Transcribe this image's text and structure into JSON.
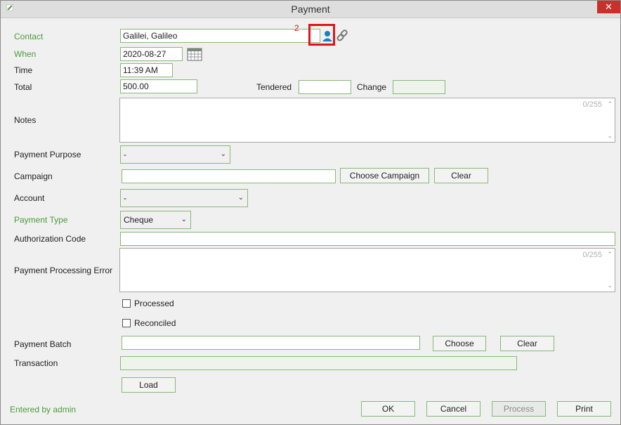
{
  "window": {
    "title": "Payment",
    "close_label": "✕"
  },
  "contact": {
    "label": "Contact",
    "value": "Galilei, Galileo",
    "badge": "2"
  },
  "when": {
    "label": "When",
    "value": "2020-08-27"
  },
  "time": {
    "label": "Time",
    "value": "11:39 AM"
  },
  "total": {
    "label": "Total",
    "value": "500.00"
  },
  "tendered": {
    "label": "Tendered",
    "value": ""
  },
  "change": {
    "label": "Change",
    "value": ""
  },
  "notes": {
    "label": "Notes",
    "counter": "0/255"
  },
  "payment_purpose": {
    "label": "Payment Purpose",
    "selected": "-"
  },
  "campaign": {
    "label": "Campaign",
    "value": "",
    "choose_label": "Choose Campaign",
    "clear_label": "Clear"
  },
  "account": {
    "label": "Account",
    "selected": "-"
  },
  "payment_type": {
    "label": "Payment Type",
    "selected": "Cheque"
  },
  "authorization_code": {
    "label": "Authorization Code",
    "value": ""
  },
  "processing_error": {
    "label": "Payment Processing Error",
    "counter": "0/255"
  },
  "processed": {
    "label": "Processed",
    "checked": false
  },
  "reconciled": {
    "label": "Reconciled",
    "checked": false
  },
  "payment_batch": {
    "label": "Payment Batch",
    "value": "",
    "choose_label": "Choose",
    "clear_label": "Clear"
  },
  "transaction": {
    "label": "Transaction",
    "value": ""
  },
  "load_label": "Load",
  "footer": {
    "entered_by": "Entered by admin",
    "ok_label": "OK",
    "cancel_label": "Cancel",
    "process_label": "Process",
    "print_label": "Print"
  },
  "icons": {
    "contact_picker": "person-icon",
    "link": "link-icon",
    "calendar": "calendar-icon",
    "dropdown": "chevron-down-icon"
  },
  "colors": {
    "accent_green": "#4c9a3c",
    "highlight_red": "#e0141a",
    "close_red": "#c8302b"
  }
}
